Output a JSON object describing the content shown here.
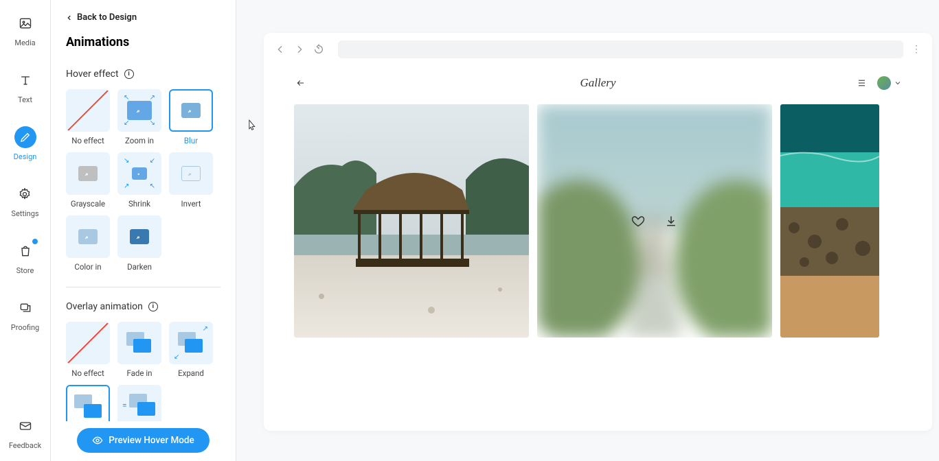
{
  "rail": {
    "items": [
      {
        "id": "media",
        "label": "Media"
      },
      {
        "id": "text",
        "label": "Text"
      },
      {
        "id": "design",
        "label": "Design"
      },
      {
        "id": "settings",
        "label": "Settings"
      },
      {
        "id": "store",
        "label": "Store"
      },
      {
        "id": "proofing",
        "label": "Proofing"
      }
    ],
    "feedback_label": "Feedback"
  },
  "panel": {
    "back_label": "Back to Design",
    "title": "Animations",
    "hover_label": "Hover effect",
    "hover_options": [
      {
        "id": "none",
        "label": "No effect"
      },
      {
        "id": "zoomin",
        "label": "Zoom in"
      },
      {
        "id": "blur",
        "label": "Blur"
      },
      {
        "id": "grayscale",
        "label": "Grayscale"
      },
      {
        "id": "shrink",
        "label": "Shrink"
      },
      {
        "id": "invert",
        "label": "Invert"
      },
      {
        "id": "colorin",
        "label": "Color in"
      },
      {
        "id": "darken",
        "label": "Darken"
      }
    ],
    "overlay_label": "Overlay animation",
    "overlay_options": [
      {
        "id": "none",
        "label": "No effect"
      },
      {
        "id": "fadein",
        "label": "Fade in"
      },
      {
        "id": "expand",
        "label": "Expand"
      },
      {
        "id": "slide",
        "label": ""
      },
      {
        "id": "swipe",
        "label": ""
      }
    ],
    "preview_button": "Preview Hover Mode"
  },
  "browser": {
    "site_title": "Gallery"
  }
}
